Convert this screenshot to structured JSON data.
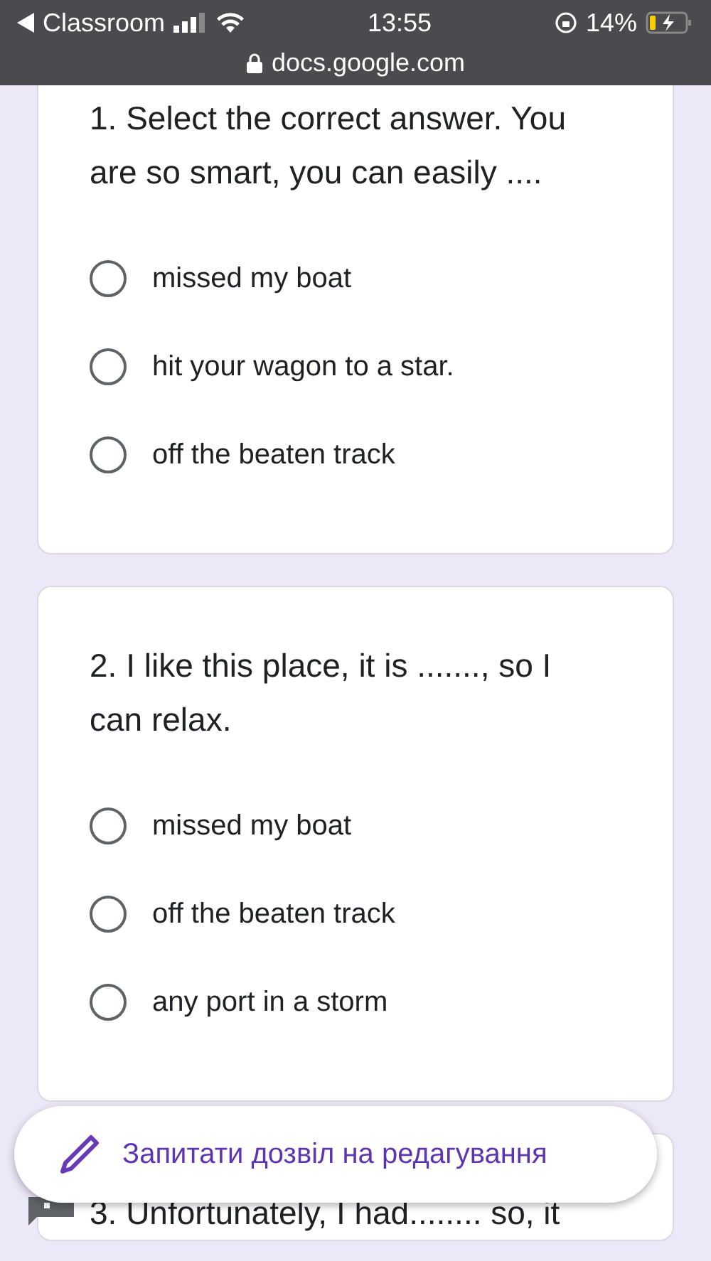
{
  "status_bar": {
    "back_app": "Classroom",
    "time": "13:55",
    "battery": "14%",
    "url": "docs.google.com"
  },
  "questions": [
    {
      "text": "1. Select the correct answer. You are so smart, you can easily ....",
      "options": [
        {
          "label": "missed my boat",
          "selected": false
        },
        {
          "label": "hit your wagon to a star.",
          "selected": false
        },
        {
          "label": "off the beaten track",
          "selected": false
        }
      ]
    },
    {
      "text": "2. I like this place, it is ......., so I can relax.",
      "options": [
        {
          "label": "missed my boat",
          "selected": false
        },
        {
          "label": "off the beaten track",
          "selected": false
        },
        {
          "label": "any port in a storm",
          "selected": false
        }
      ]
    },
    {
      "text": "3. Unfortunately, I had........ so, it"
    }
  ],
  "edit_button": "Запитати дозвіл на редагування"
}
